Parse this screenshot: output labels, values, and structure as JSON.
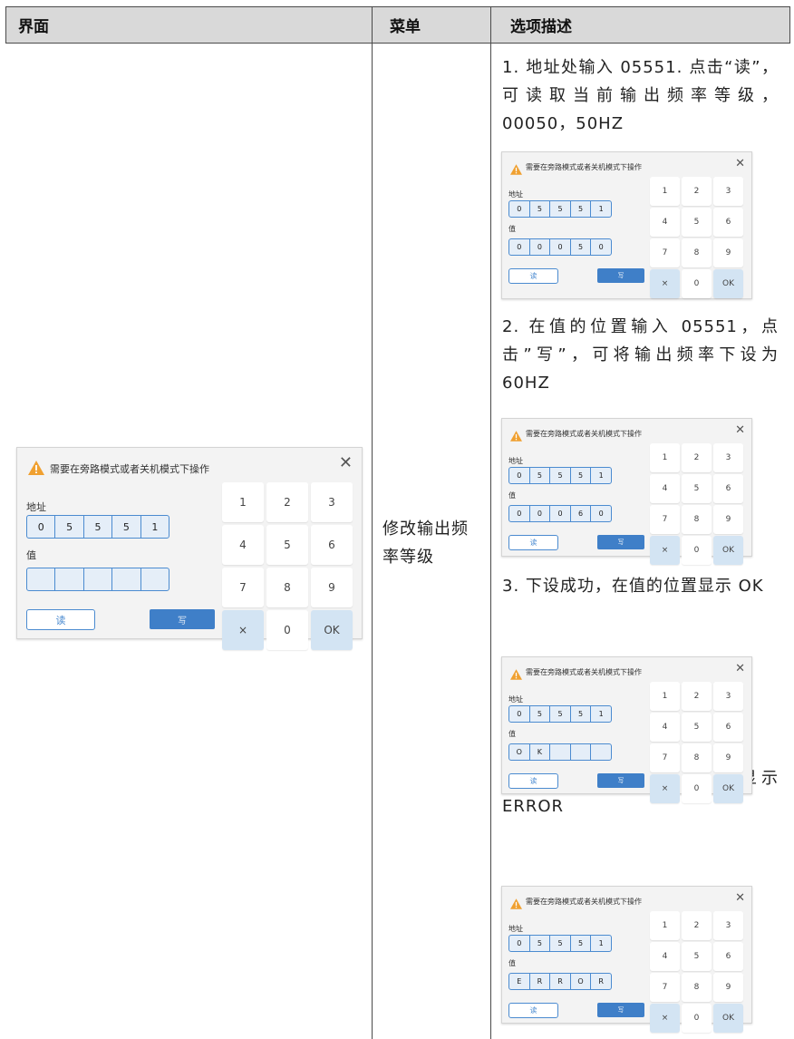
{
  "table": {
    "headers": [
      "界面",
      "菜单",
      "选项描述"
    ],
    "menu": "修改输出频率等级"
  },
  "descriptions": [
    "1. 地址处输入 05551. 点击“读”，可读取当前输出频率等级，00050，50HZ",
    "2. 在值的位置输入 05551，点击”写”，可将输出频率下设为 60HZ",
    "3. 下设成功，在值的位置显示 OK",
    "4. 下设失败，在值的位置显示 ERROR"
  ],
  "dialog_text": {
    "title": "需要在旁路模式或者关机模式下操作",
    "address_label": "地址",
    "value_label": "值",
    "read_label": "读",
    "write_label": "写",
    "keypad": [
      "1",
      "2",
      "3",
      "4",
      "5",
      "6",
      "7",
      "8",
      "9",
      "×",
      "0",
      "OK"
    ]
  },
  "dialogs": [
    {
      "address": [
        "0",
        "5",
        "5",
        "5",
        "1"
      ],
      "value": [
        "",
        "",
        "",
        "",
        ""
      ]
    },
    {
      "address": [
        "0",
        "5",
        "5",
        "5",
        "1"
      ],
      "value": [
        "0",
        "0",
        "0",
        "5",
        "0"
      ]
    },
    {
      "address": [
        "0",
        "5",
        "5",
        "5",
        "1"
      ],
      "value": [
        "0",
        "0",
        "0",
        "6",
        "0"
      ]
    },
    {
      "address": [
        "0",
        "5",
        "5",
        "5",
        "1"
      ],
      "value": [
        "O",
        "K",
        "",
        "",
        ""
      ]
    },
    {
      "address": [
        "0",
        "5",
        "5",
        "5",
        "1"
      ],
      "value": [
        "E",
        "R",
        "R",
        "O",
        "R"
      ]
    }
  ],
  "colors": {
    "accent": "#3f7fc8",
    "field_border": "#4b8bd0",
    "warning": "#f0a030",
    "header_bg": "#d9d9d9"
  }
}
